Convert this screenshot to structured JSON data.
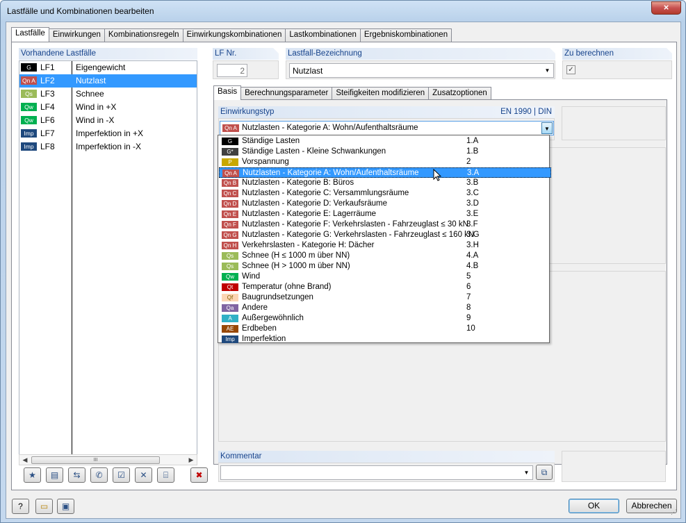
{
  "window": {
    "title": "Lastfälle und Kombinationen bearbeiten"
  },
  "main_tabs": [
    "Lastfälle",
    "Einwirkungen",
    "Kombinationsregeln",
    "Einwirkungskombinationen",
    "Lastkombinationen",
    "Ergebniskombinationen"
  ],
  "loadcase_panel": {
    "header": "Vorhandene Lastfälle",
    "items": [
      {
        "badge": "G",
        "badge_color": "#000000",
        "id": "LF1",
        "name": "Eigengewicht"
      },
      {
        "badge": "Qn A",
        "badge_color": "#c0504d",
        "id": "LF2",
        "name": "Nutzlast"
      },
      {
        "badge": "Qs",
        "badge_color": "#9bbb59",
        "id": "LF3",
        "name": "Schnee"
      },
      {
        "badge": "Qw",
        "badge_color": "#00b050",
        "id": "LF4",
        "name": "Wind in +X"
      },
      {
        "badge": "Qw",
        "badge_color": "#00b050",
        "id": "LF6",
        "name": "Wind in -X"
      },
      {
        "badge": "Imp",
        "badge_color": "#1f497d",
        "id": "LF7",
        "name": "Imperfektion in +X"
      },
      {
        "badge": "Imp",
        "badge_color": "#1f497d",
        "id": "LF8",
        "name": "Imperfektion in -X"
      }
    ],
    "scroll_thumb": "III"
  },
  "lf_nr": {
    "label": "LF Nr.",
    "value": "2"
  },
  "bezeichnung": {
    "label": "Lastfall-Bezeichnung",
    "value": "Nutzlast"
  },
  "zu_berechnen": {
    "label": "Zu berechnen",
    "checked": "✓"
  },
  "sub_tabs": [
    "Basis",
    "Berechnungsparameter",
    "Steifigkeiten modifizieren",
    "Zusatzoptionen"
  ],
  "einwirkungstyp": {
    "label": "Einwirkungstyp",
    "norm": "EN 1990 | DIN",
    "selected_badge": "Qn A",
    "selected_label": "Nutzlasten - Kategorie A: Wohn/Aufenthaltsräume"
  },
  "dropdown_items": [
    {
      "badge": "G",
      "color": "#000000",
      "text_color": "#ffffff",
      "label": "Ständige Lasten",
      "code": "1.A"
    },
    {
      "badge": "G*",
      "color": "#404040",
      "text_color": "#ffffff",
      "label": "Ständige Lasten - Kleine Schwankungen",
      "code": "1.B"
    },
    {
      "badge": "P",
      "color": "#c9a800",
      "text_color": "#ffffff",
      "label": "Vorspannung",
      "code": "2"
    },
    {
      "badge": "Qn A",
      "color": "#c0504d",
      "text_color": "#ffffff",
      "label": "Nutzlasten - Kategorie A: Wohn/Aufenthaltsräume",
      "code": "3.A"
    },
    {
      "badge": "Qn B",
      "color": "#c0504d",
      "text_color": "#ffffff",
      "label": "Nutzlasten - Kategorie B: Büros",
      "code": "3.B"
    },
    {
      "badge": "Qn C",
      "color": "#c0504d",
      "text_color": "#ffffff",
      "label": "Nutzlasten - Kategorie C: Versammlungsräume",
      "code": "3.C"
    },
    {
      "badge": "Qn D",
      "color": "#c0504d",
      "text_color": "#ffffff",
      "label": "Nutzlasten - Kategorie D: Verkaufsräume",
      "code": "3.D"
    },
    {
      "badge": "Qn E",
      "color": "#c0504d",
      "text_color": "#ffffff",
      "label": "Nutzlasten - Kategorie E: Lagerräume",
      "code": "3.E"
    },
    {
      "badge": "Qn F",
      "color": "#c0504d",
      "text_color": "#ffffff",
      "label": "Nutzlasten - Kategorie F: Verkehrslasten - Fahrzeuglast ≤ 30 kN",
      "code": "3.F"
    },
    {
      "badge": "Qn G",
      "color": "#c0504d",
      "text_color": "#ffffff",
      "label": "Nutzlasten - Kategorie G: Verkehrslasten - Fahrzeuglast ≤ 160 kN",
      "code": "3.G"
    },
    {
      "badge": "Qn H",
      "color": "#c0504d",
      "text_color": "#ffffff",
      "label": "Verkehrslasten - Kategorie H: Dächer",
      "code": "3.H"
    },
    {
      "badge": "Qs",
      "color": "#9bbb59",
      "text_color": "#ffffff",
      "label": "Schnee (H ≤ 1000 m über NN)",
      "code": "4.A"
    },
    {
      "badge": "Qs",
      "color": "#9bbb59",
      "text_color": "#ffffff",
      "label": "Schnee (H > 1000 m über NN)",
      "code": "4.B"
    },
    {
      "badge": "Qw",
      "color": "#00b050",
      "text_color": "#ffffff",
      "label": "Wind",
      "code": "5"
    },
    {
      "badge": "Qt",
      "color": "#c00000",
      "text_color": "#ffffff",
      "label": "Temperatur (ohne Brand)",
      "code": "6"
    },
    {
      "badge": "Qf",
      "color": "#fcd5b4",
      "text_color": "#7f6000",
      "label": "Baugrundsetzungen",
      "code": "7"
    },
    {
      "badge": "Qa",
      "color": "#8064a2",
      "text_color": "#ffffff",
      "label": "Andere",
      "code": "8"
    },
    {
      "badge": "A",
      "color": "#31b0c6",
      "text_color": "#ffffff",
      "label": "Außergewöhnlich",
      "code": "9"
    },
    {
      "badge": "AE",
      "color": "#974806",
      "text_color": "#ffffff",
      "label": "Erdbeben",
      "code": "10"
    },
    {
      "badge": "Imp",
      "color": "#1f497d",
      "text_color": "#ffffff",
      "label": "Imperfektion",
      "code": ""
    }
  ],
  "dropdown_selected_index": 3,
  "kommentar": {
    "label": "Kommentar",
    "value": ""
  },
  "buttons": {
    "ok": "OK",
    "cancel": "Abbrechen"
  },
  "colors": {
    "accent": "#3399ff",
    "group_header_text": "#15428b",
    "close_red": "#c75050"
  },
  "icons": {
    "close": "×",
    "combo_arrow": "▼",
    "scroll_left": "◀",
    "scroll_right": "▶",
    "tools": [
      "★",
      "▤",
      "⇆",
      "✆",
      "☑",
      "✕",
      "⌸",
      "✖"
    ],
    "help": "?",
    "open": "▭",
    "save": "▣",
    "kommentar_browse": "⧉",
    "grip": "⋰"
  }
}
